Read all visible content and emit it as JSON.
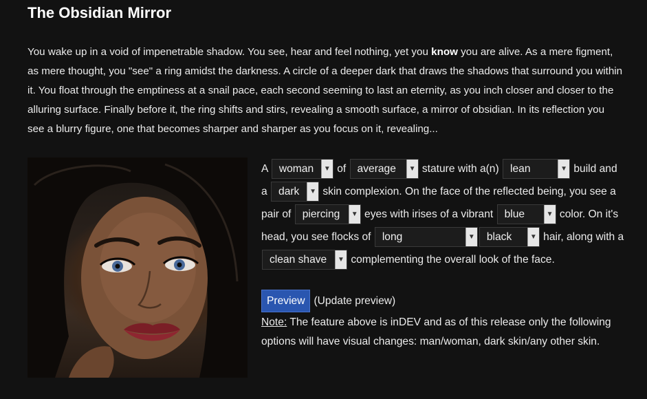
{
  "title": "The Obsidian Mirror",
  "intro": {
    "part1": "You wake up in a void of impenetrable shadow. You see, hear and feel nothing, yet you ",
    "emph": "know",
    "part2": " you are alive. As a mere figment, as mere thought, you \"see\" a ring amidst the darkness. A circle of a deeper dark that draws the shadows that surround you within it. You float through the emptiness at a snail pace, each second seeming to last an eternity, as you inch closer and closer to the alluring surface. Finally before it, the ring shifts and stirs, revealing a smooth surface, a mirror of obsidian. In its reflection you see a blurry figure, one that becomes sharper and sharper as you focus on it, revealing..."
  },
  "form": {
    "t1": "A ",
    "gender": "woman",
    "t2": " of ",
    "stature": "average",
    "t3": " stature with a(n) ",
    "build": "lean",
    "t4": " build and a ",
    "skin": "dark",
    "t5": " skin complexion. On the face of the reflected being, you see a pair of ",
    "eyes": "piercing",
    "t6": " eyes with irises of a vibrant ",
    "iris": "blue",
    "t7": " color. On it's head, you see flocks of ",
    "hair_length": "long",
    "hair_color": "black",
    "t8": " hair, along with a ",
    "facial": "clean shave",
    "t9": " complementing the overall look of the face."
  },
  "preview": {
    "button_label": "Preview",
    "hint": "(Update preview)"
  },
  "note": {
    "label": "Note:",
    "text": " The feature above is inDEV and as of this release only the following options will have visual changes: man/woman, dark skin/any other skin."
  },
  "icons": {
    "dropdown": "chevron-down-icon"
  },
  "colors": {
    "background": "#121212",
    "button": "#2a56b0"
  }
}
